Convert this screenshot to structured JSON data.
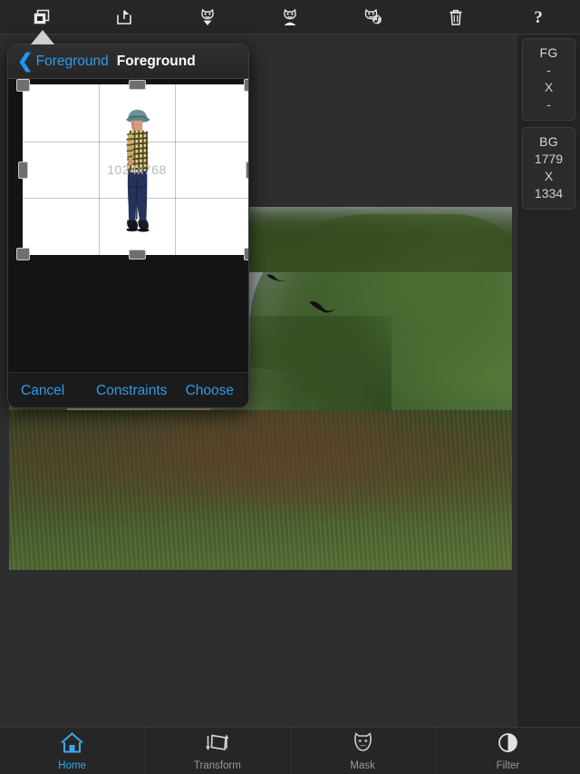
{
  "app": {
    "accent_blue": "#2f9ae3",
    "bar_bg": "#262626",
    "canvas_bg": "#2e2e2e",
    "sidebar_bg": "#232323"
  },
  "topbar": {
    "tools": [
      {
        "name": "layers-duplicate-icon",
        "label": "Duplicate"
      },
      {
        "name": "share-icon",
        "label": "Share"
      },
      {
        "name": "mask-import-icon",
        "label": "Import Mask"
      },
      {
        "name": "mask-person-icon",
        "label": "Mask Subject"
      },
      {
        "name": "mask-music-icon",
        "label": "Mask Audio"
      },
      {
        "name": "trash-icon",
        "label": "Delete"
      },
      {
        "name": "help-icon",
        "label": "?"
      }
    ]
  },
  "popover": {
    "back_label": "Foreground",
    "title": "Foreground",
    "crop": {
      "dimension_label": "1024x768",
      "grid": true,
      "handles": [
        "top-left",
        "top-center",
        "top-right",
        "middle-left",
        "middle-right",
        "bottom-left",
        "bottom-center",
        "bottom-right"
      ],
      "subject": "person-standing-profile"
    },
    "footer": {
      "cancel": "Cancel",
      "constraints": "Constraints",
      "choose": "Choose"
    }
  },
  "sidebar": {
    "cards": [
      {
        "title": "FG",
        "width": "-",
        "sep": "X",
        "height": "-"
      },
      {
        "title": "BG",
        "width": "1779",
        "sep": "X",
        "height": "1334"
      }
    ]
  },
  "canvas": {
    "background_photo": "abandoned-white-farmhouse-with-trees-and-overgrown-field",
    "birds": 2
  },
  "tabbar": {
    "tabs": [
      {
        "label": "Home",
        "icon": "home-icon",
        "active": true
      },
      {
        "label": "Transform",
        "icon": "transform-icon",
        "active": false
      },
      {
        "label": "Mask",
        "icon": "mask-icon",
        "active": false
      },
      {
        "label": "Filter",
        "icon": "filter-contrast-icon",
        "active": false
      }
    ]
  }
}
